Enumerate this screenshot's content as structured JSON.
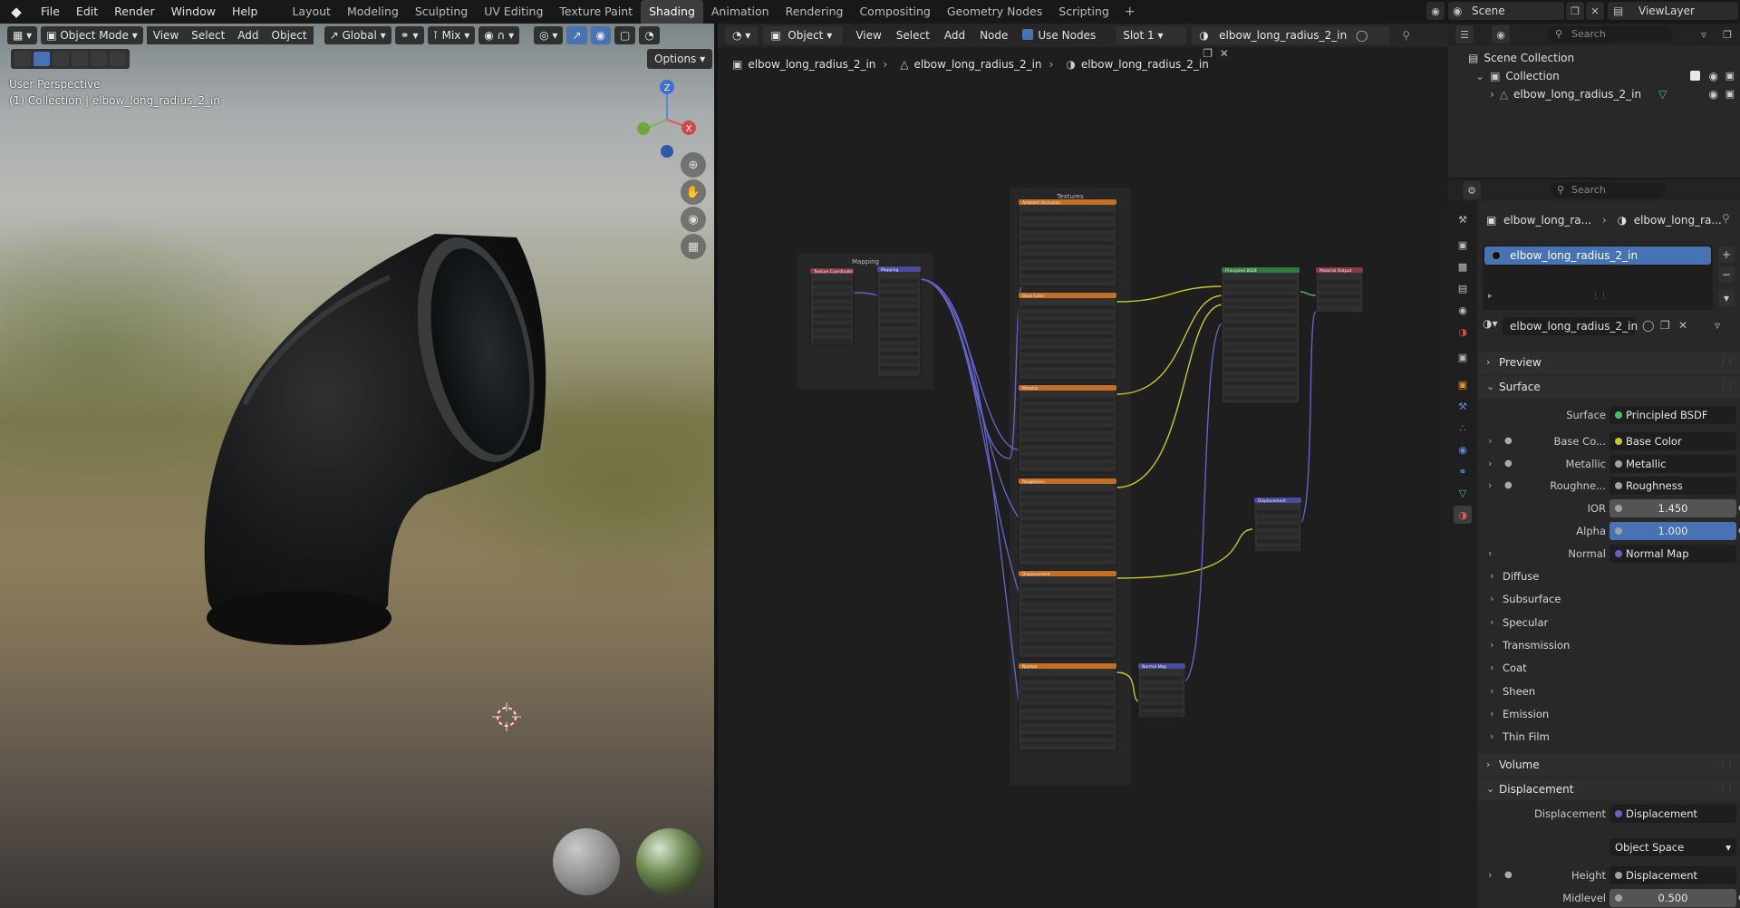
{
  "menu": [
    "File",
    "Edit",
    "Render",
    "Window",
    "Help"
  ],
  "workspaces": [
    {
      "label": "Layout",
      "active": false
    },
    {
      "label": "Modeling",
      "active": false
    },
    {
      "label": "Sculpting",
      "active": false
    },
    {
      "label": "UV Editing",
      "active": false
    },
    {
      "label": "Texture Paint",
      "active": false
    },
    {
      "label": "Shading",
      "active": true
    },
    {
      "label": "Animation",
      "active": false
    },
    {
      "label": "Rendering",
      "active": false
    },
    {
      "label": "Compositing",
      "active": false
    },
    {
      "label": "Geometry Nodes",
      "active": false
    },
    {
      "label": "Scripting",
      "active": false
    }
  ],
  "workspace_add": "+",
  "scene": "Scene",
  "view_layer": "ViewLayer",
  "viewport": {
    "mode": "Object Mode",
    "menus": [
      "View",
      "Select",
      "Add",
      "Object"
    ],
    "orientation": "Global",
    "blend": "Mix",
    "options": "Options",
    "info_line1": "User Perspective",
    "info_line2": "(1) Collection | elbow_long_radius_2_in",
    "gizmo": {
      "z": "Z",
      "x": "X"
    }
  },
  "node_editor": {
    "object_type": "Object",
    "menus": [
      "View",
      "Select",
      "Add",
      "Node"
    ],
    "use_nodes_label": "Use Nodes",
    "slot": "Slot 1",
    "material": "elbow_long_radius_2_in",
    "breadcrumb": [
      "elbow_long_radius_2_in",
      "elbow_long_radius_2_in",
      "elbow_long_radius_2_in"
    ],
    "frames": {
      "mapping": "Mapping",
      "textures": "Textures"
    },
    "nodes": {
      "tex_coord": "Texture Coordinate",
      "mapping": "Mapping",
      "principled": "Principled BSDF",
      "output": "Material Output",
      "displacement": "Displacement",
      "normal_map": "Normal Map",
      "textures": [
        "Ambient Occlusion",
        "Base Color",
        "Metallic",
        "Roughness",
        "Displacement",
        "Normal"
      ]
    }
  },
  "outliner": {
    "search_placeholder": "Search",
    "scene_collection": "Scene Collection",
    "collection": "Collection",
    "object": "elbow_long_radius_2_in"
  },
  "properties": {
    "search_placeholder": "Search",
    "crumb_object": "elbow_long_ra...",
    "crumb_material": "elbow_long_ra...",
    "slot_item": "elbow_long_radius_2_in",
    "material_field": "elbow_long_radius_2_in",
    "panels": {
      "preview": "Preview",
      "surface": "Surface",
      "volume": "Volume",
      "displacement": "Displacement"
    },
    "surface_rows": [
      {
        "label": "Surface",
        "value": "Principled BSDF",
        "sock": "#44c267",
        "expand": false,
        "link": false
      },
      {
        "label": "Base Co...",
        "value": "Base Color",
        "sock": "#c7c729",
        "expand": true,
        "link": true
      },
      {
        "label": "Metallic",
        "value": "Metallic",
        "sock": "#a1a1a1",
        "expand": true,
        "link": true
      },
      {
        "label": "Roughne...",
        "value": "Roughness",
        "sock": "#a1a1a1",
        "expand": true,
        "link": true
      },
      {
        "label": "IOR",
        "value": "1.450",
        "num": true,
        "sel": false
      },
      {
        "label": "Alpha",
        "value": "1.000",
        "num": true,
        "sel": true
      },
      {
        "label": "Normal",
        "value": "Normal Map",
        "sock": "#6363c7",
        "expand": true,
        "link": false
      }
    ],
    "subpanels": [
      "Diffuse",
      "Subsurface",
      "Specular",
      "Transmission",
      "Coat",
      "Sheen",
      "Emission",
      "Thin Film"
    ],
    "displacement_rows": {
      "displacement_label": "Displacement",
      "displacement_value": "Displacement",
      "space": "Object Space",
      "height_label": "Height",
      "height_value": "Displacement",
      "midlevel_label": "Midlevel",
      "midlevel_value": "0.500"
    },
    "colors": {
      "selected": "#4772b3",
      "yellow_socket": "#c7c729",
      "grey_socket": "#a1a1a1",
      "vector_socket": "#6363c7",
      "shader_socket": "#44c267"
    }
  }
}
